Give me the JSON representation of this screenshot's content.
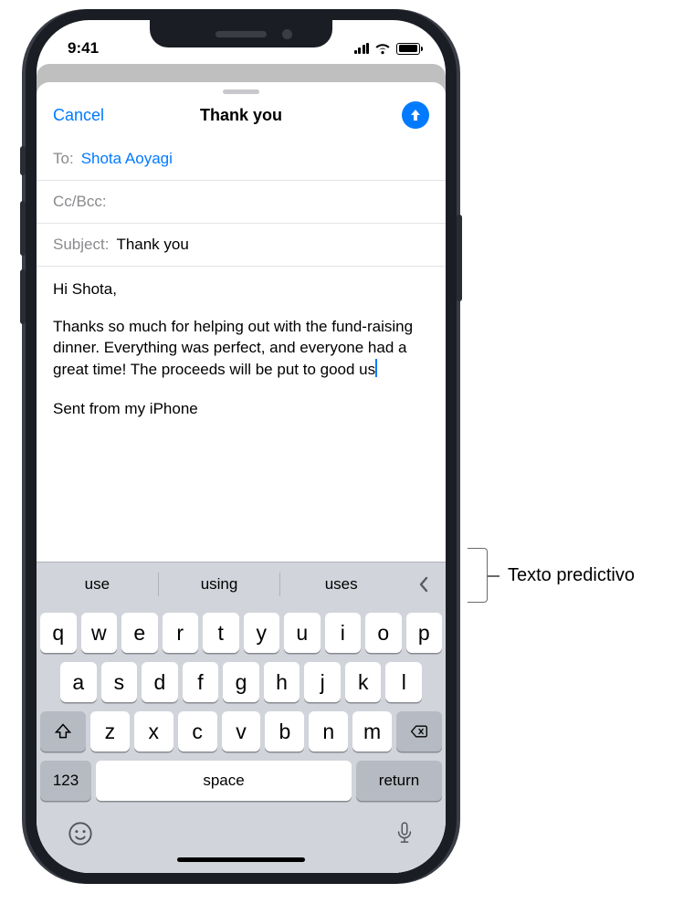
{
  "status": {
    "time": "9:41"
  },
  "sheet": {
    "cancel": "Cancel",
    "title": "Thank you"
  },
  "fields": {
    "to_label": "To:",
    "to_value": "Shota Aoyagi",
    "cc_label": "Cc/Bcc:",
    "subject_label": "Subject:",
    "subject_value": "Thank you"
  },
  "body": {
    "greeting": "Hi Shota,",
    "paragraph": "Thanks so much for helping out with the fund-raising dinner. Everything was perfect, and everyone had a great time! The proceeds will be put to good us",
    "signature": "Sent from my iPhone"
  },
  "predictive": {
    "s1": "use",
    "s2": "using",
    "s3": "uses"
  },
  "keys": {
    "row1": [
      "q",
      "w",
      "e",
      "r",
      "t",
      "y",
      "u",
      "i",
      "o",
      "p"
    ],
    "row2": [
      "a",
      "s",
      "d",
      "f",
      "g",
      "h",
      "j",
      "k",
      "l"
    ],
    "row3": [
      "z",
      "x",
      "c",
      "v",
      "b",
      "n",
      "m"
    ],
    "num": "123",
    "space": "space",
    "return": "return"
  },
  "annotation": {
    "label": "Texto predictivo"
  }
}
